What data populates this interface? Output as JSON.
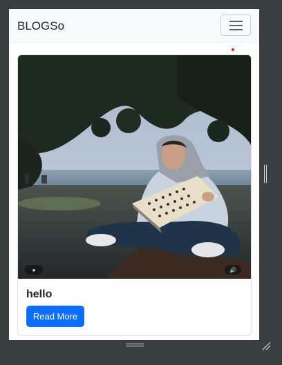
{
  "navbar": {
    "brand": "BLOGSo",
    "toggler_icon": "hamburger-menu-icon"
  },
  "post": {
    "media": "video",
    "media_description_icons": [
      "user-avatar-icon",
      "volume-icon"
    ],
    "title": "hello",
    "read_more_label": "Read More"
  },
  "viewport": {
    "resize_handles": [
      "side-resize-handle",
      "bottom-resize-handle",
      "corner-resize-grip"
    ]
  },
  "colors": {
    "background": "#37403f",
    "navbar": "#f8f9fa",
    "primary_button": "#0d6efd",
    "indicator_dot": "#e02020"
  }
}
